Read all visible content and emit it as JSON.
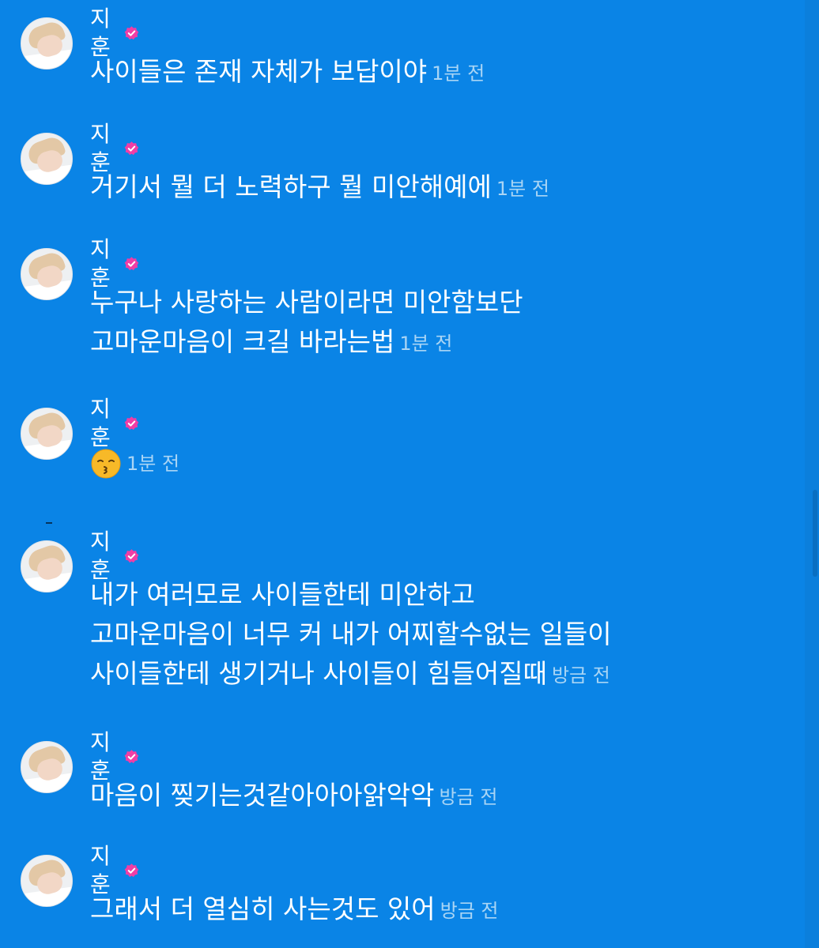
{
  "messages": [
    {
      "author": "지훈",
      "lines": [
        "사이들은 존재 자체가 보답이야"
      ],
      "time": "1분 전"
    },
    {
      "author": "지훈",
      "lines": [
        "거기서 뭘 더 노력하구 뭘 미안해예에"
      ],
      "time": "1분 전"
    },
    {
      "author": "지훈",
      "lines": [
        "누구나 사랑하는 사람이라면 미안함보단",
        "고마운마음이 크길 바라는법"
      ],
      "time": "1분 전"
    },
    {
      "author": "지훈",
      "emoji": "kissing-face-emoji",
      "time": "1분 전"
    },
    {
      "author": "지훈",
      "lines": [
        "내가 여러모로 사이들한테 미안하고",
        "고마운마음이 너무 커 내가 어찌할수없는 일들이",
        "사이들한테 생기거나 사이들이 힘들어질때"
      ],
      "time": "방금 전"
    },
    {
      "author": "지훈",
      "lines": [
        "마음이 찢기는것같아아아앍악악"
      ],
      "time": "방금 전"
    },
    {
      "author": "지훈",
      "lines": [
        "그래서 더 열심히 사는것도 있어"
      ],
      "time": "방금 전"
    }
  ],
  "colors": {
    "background": "#0a84e6",
    "text": "#ffffff",
    "timestamp": "#a9d5f5",
    "verified_badge": "#f03ea6"
  },
  "icons": {
    "verified": "verified-badge-icon",
    "avatar": "avatar"
  }
}
